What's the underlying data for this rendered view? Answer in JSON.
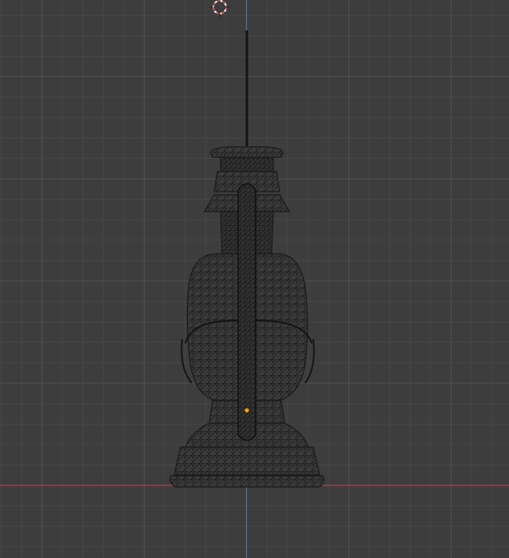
{
  "viewport": {
    "view": "front-orthographic",
    "shading": "wireframe",
    "object": "oil-lantern",
    "colors": {
      "background": "#3d3d3d",
      "grid_minor": "#474747",
      "grid_major": "#4f4f4f",
      "axis_x": "#a8424d",
      "axis_z": "#3f78b8",
      "wire": "#1c1c1c",
      "origin": "#f0a020",
      "cursor_red": "#d65a50",
      "cursor_white": "#ffffff"
    },
    "icons": [
      "3d-cursor-icon",
      "object-origin-icon"
    ]
  }
}
